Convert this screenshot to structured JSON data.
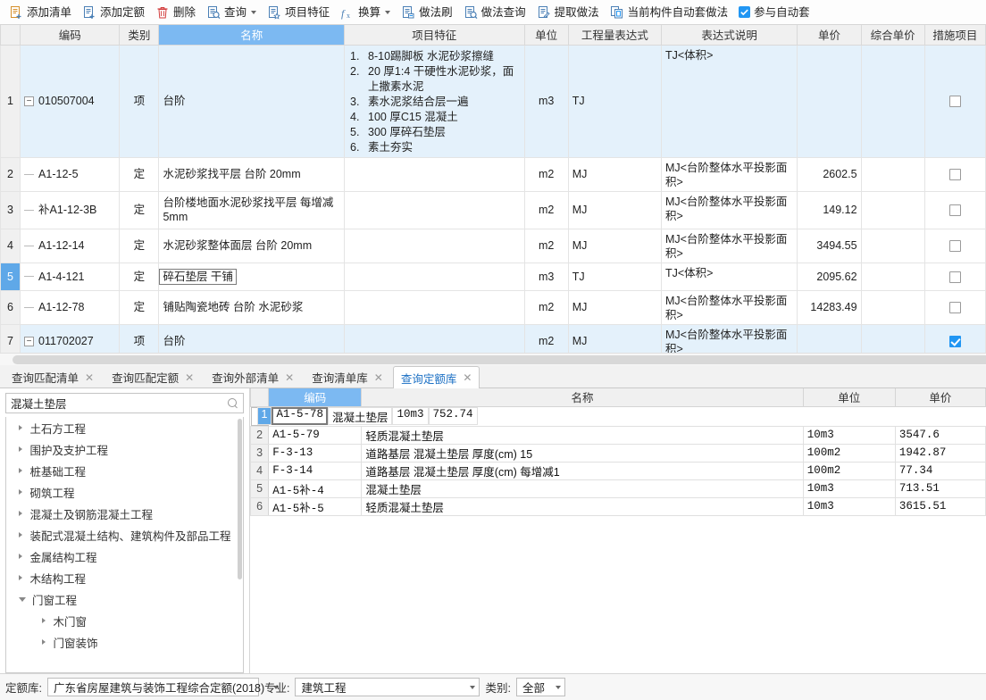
{
  "toolbar": {
    "items": [
      {
        "label": "添加清单",
        "icon": "list-add-icon",
        "caret": false
      },
      {
        "label": "添加定额",
        "icon": "quota-add-icon",
        "caret": false
      },
      {
        "label": "删除",
        "icon": "trash-icon",
        "caret": false
      },
      {
        "label": "查询",
        "icon": "search-doc-icon",
        "caret": true
      },
      {
        "label": "项目特征",
        "icon": "feature-doc-icon",
        "caret": false
      },
      {
        "label": "换算",
        "icon": "fx-icon",
        "caret": true
      },
      {
        "label": "做法刷",
        "icon": "method-brush-icon",
        "caret": false
      },
      {
        "label": "做法查询",
        "icon": "method-search-icon",
        "caret": false
      },
      {
        "label": "提取做法",
        "icon": "method-extract-icon",
        "caret": false
      },
      {
        "label": "当前构件自动套做法",
        "icon": "auto-apply-icon",
        "caret": false
      }
    ],
    "auto_checkbox": {
      "label": "参与自动套",
      "checked": true
    }
  },
  "main_grid": {
    "columns": [
      "",
      "编码",
      "类别",
      "名称",
      "项目特征",
      "单位",
      "工程量表达式",
      "表达式说明",
      "单价",
      "综合单价",
      "措施项目"
    ],
    "selected_column": "名称",
    "rows": [
      {
        "idx": "1",
        "kind": "quota-item",
        "expander": "−",
        "code": "010507004",
        "type": "项",
        "name": "台阶",
        "features": [
          "8-10踢脚板 水泥砂浆擦缝",
          "20 厚1:4 干硬性水泥砂浆，面上撒素水泥",
          "素水泥浆结合层一遍",
          "100 厚C15 混凝土",
          "300 厚碎石垫层",
          "素土夯实"
        ],
        "unit": "m3",
        "qty_expr": "TJ",
        "expr_desc": "TJ<体积>",
        "price": "",
        "comp_price": "",
        "measure_checked": false,
        "selected": false
      },
      {
        "idx": "2",
        "kind": "sub",
        "expander": "",
        "code": "A1-12-5",
        "type": "定",
        "name": "水泥砂浆找平层 台阶 20mm",
        "features": [],
        "unit": "m2",
        "qty_expr": "MJ",
        "expr_desc": "MJ<台阶整体水平投影面积>",
        "price": "2602.5",
        "comp_price": "",
        "measure_checked": false,
        "selected": false
      },
      {
        "idx": "3",
        "kind": "sub",
        "expander": "",
        "code": "补A1-12-3B",
        "type": "定",
        "name": "台阶楼地面水泥砂浆找平层 每增减5mm",
        "features": [],
        "unit": "m2",
        "qty_expr": "MJ",
        "expr_desc": "MJ<台阶整体水平投影面积>",
        "price": "149.12",
        "comp_price": "",
        "measure_checked": false,
        "selected": false
      },
      {
        "idx": "4",
        "kind": "sub",
        "expander": "",
        "code": "A1-12-14",
        "type": "定",
        "name": "水泥砂浆整体面层 台阶 20mm",
        "features": [],
        "unit": "m2",
        "qty_expr": "MJ",
        "expr_desc": "MJ<台阶整体水平投影面积>",
        "price": "3494.55",
        "comp_price": "",
        "measure_checked": false,
        "selected": false
      },
      {
        "idx": "5",
        "kind": "sub",
        "expander": "",
        "code": "A1-4-121",
        "type": "定",
        "name": "碎石垫层 干铺",
        "features": [],
        "unit": "m3",
        "qty_expr": "TJ",
        "expr_desc": "TJ<体积>",
        "price": "2095.62",
        "comp_price": "",
        "measure_checked": false,
        "selected": true
      },
      {
        "idx": "6",
        "kind": "sub",
        "expander": "",
        "code": "A1-12-78",
        "type": "定",
        "name": "铺贴陶瓷地砖 台阶 水泥砂浆",
        "features": [],
        "unit": "m2",
        "qty_expr": "MJ",
        "expr_desc": "MJ<台阶整体水平投影面积>",
        "price": "14283.49",
        "comp_price": "",
        "measure_checked": false,
        "selected": false
      },
      {
        "idx": "7",
        "kind": "quota-item",
        "expander": "−",
        "code": "011702027",
        "type": "项",
        "name": "台阶",
        "features": [],
        "unit": "m2",
        "qty_expr": "MJ",
        "expr_desc": "MJ<台阶整体水平投影面积>",
        "price": "",
        "comp_price": "",
        "measure_checked": true,
        "selected": false
      },
      {
        "idx": "",
        "kind": "partial",
        "expander": "",
        "code": "",
        "type": "",
        "name": "",
        "features": [],
        "unit": "",
        "qty_expr": "",
        "expr_desc": "MJ<台阶整体水平投影面积>",
        "price": "",
        "comp_price": "",
        "measure_checked": false,
        "selected": false
      }
    ]
  },
  "tabs": {
    "items": [
      {
        "label": "查询匹配清单",
        "active": false
      },
      {
        "label": "查询匹配定额",
        "active": false
      },
      {
        "label": "查询外部清单",
        "active": false
      },
      {
        "label": "查询清单库",
        "active": false
      },
      {
        "label": "查询定额库",
        "active": true
      }
    ],
    "close_glyph": "✕"
  },
  "tree_panel": {
    "search": {
      "value": "混凝土垫层",
      "placeholder": "",
      "icon": "search-icon"
    },
    "nodes": [
      {
        "label": "土石方工程",
        "level": 1,
        "expanded": false
      },
      {
        "label": "围护及支护工程",
        "level": 1,
        "expanded": false
      },
      {
        "label": "桩基础工程",
        "level": 1,
        "expanded": false
      },
      {
        "label": "砌筑工程",
        "level": 1,
        "expanded": false
      },
      {
        "label": "混凝土及钢筋混凝土工程",
        "level": 1,
        "expanded": false
      },
      {
        "label": "装配式混凝土结构、建筑构件及部品工程",
        "level": 1,
        "expanded": false
      },
      {
        "label": "金属结构工程",
        "level": 1,
        "expanded": false
      },
      {
        "label": "木结构工程",
        "level": 1,
        "expanded": false
      },
      {
        "label": "门窗工程",
        "level": 1,
        "expanded": true
      },
      {
        "label": "木门窗",
        "level": 2,
        "expanded": false
      },
      {
        "label": "门窗装饰",
        "level": 2,
        "expanded": false
      }
    ]
  },
  "detail_grid": {
    "columns": [
      "",
      "编码",
      "名称",
      "单位",
      "单价"
    ],
    "selected_column": "编码",
    "rows": [
      {
        "idx": "1",
        "code": "A1-5-78",
        "name": "混凝土垫层",
        "unit": "10m3",
        "price": "752.74",
        "selected": true
      },
      {
        "idx": "2",
        "code": "A1-5-79",
        "name": "轻质混凝土垫层",
        "unit": "10m3",
        "price": "3547.6",
        "selected": false
      },
      {
        "idx": "3",
        "code": "F-3-13",
        "name": "道路基层  混凝土垫层  厚度(cm) 15",
        "unit": "100m2",
        "price": "1942.87",
        "selected": false
      },
      {
        "idx": "4",
        "code": "F-3-14",
        "name": "道路基层  混凝土垫层  厚度(cm) 每增减1",
        "unit": "100m2",
        "price": "77.34",
        "selected": false
      },
      {
        "idx": "5",
        "code": "A1-5补-4",
        "name": "混凝土垫层",
        "unit": "10m3",
        "price": "713.51",
        "selected": false
      },
      {
        "idx": "6",
        "code": "A1-5补-5",
        "name": "轻质混凝土垫层",
        "unit": "10m3",
        "price": "3615.51",
        "selected": false
      }
    ]
  },
  "statusbar": {
    "quota_lib_label": "定额库:",
    "quota_lib_value": "广东省房屋建筑与装饰工程综合定额(2018)",
    "major_label": "专业:",
    "major_value": "建筑工程",
    "category_label": "类别:",
    "category_value": "全部"
  },
  "colors": {
    "accent": "#2196f3",
    "header_selected": "#7cb9f2",
    "row_highlight": "#e4f1fb",
    "row_index_selected": "#5fa8e8"
  }
}
